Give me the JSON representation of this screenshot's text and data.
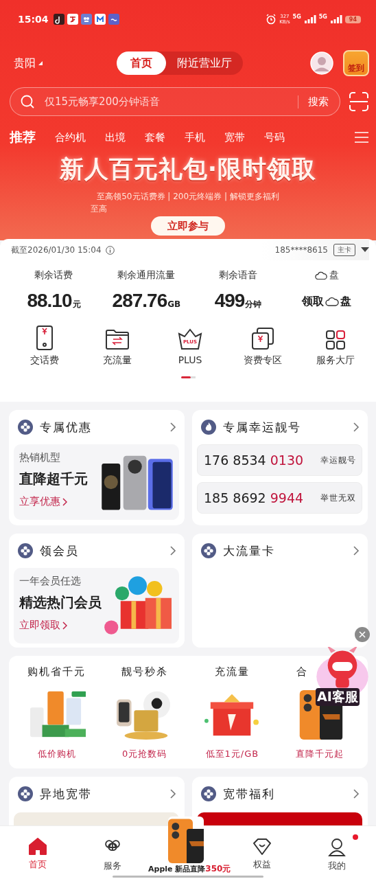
{
  "status_bar": {
    "time": "15:04",
    "speed": "327",
    "speed_unit": "KB/s",
    "network_1": "5G",
    "network_2": "5G",
    "battery": "94"
  },
  "header": {
    "city": "贵阳",
    "tabs": [
      {
        "label": "首页",
        "selected": true
      },
      {
        "label": "附近营业厅",
        "selected": false
      }
    ],
    "checkin": "签到"
  },
  "search": {
    "placeholder": "仅15元畅享200分钟语音",
    "button": "搜索"
  },
  "categories": [
    {
      "label": "推荐",
      "selected": true
    },
    {
      "label": "合约机",
      "selected": false
    },
    {
      "label": "出境",
      "selected": false
    },
    {
      "label": "套餐",
      "selected": false
    },
    {
      "label": "手机",
      "selected": false
    },
    {
      "label": "宽带",
      "selected": false
    },
    {
      "label": "号码",
      "selected": false
    }
  ],
  "banner": {
    "title": "新人百元礼包·限时领取",
    "subtitle": "至高领50元话费券 | 200元终端券 | 解锁更多福利",
    "subtitle_2": "至高",
    "button": "立即参与"
  },
  "account": {
    "timestamp": "截至2026/01/30 15:04",
    "phone": "185****8615",
    "card_tag": "主卡"
  },
  "balances": [
    {
      "kind": "amount",
      "label": "剩余话费",
      "value": "88.10",
      "unit": "元"
    },
    {
      "kind": "amount",
      "label": "剩余通用流量",
      "value": "287.76",
      "unit": "GB"
    },
    {
      "kind": "amount",
      "label": "剩余语音",
      "value": "499",
      "unit": "分钟"
    },
    {
      "kind": "cloud",
      "label": "盘",
      "value": "领取",
      "unit": "盘"
    }
  ],
  "shortcuts": [
    {
      "label": "交话费"
    },
    {
      "label": "充流量"
    },
    {
      "label": "PLUS",
      "icon_text": "PLUS"
    },
    {
      "label": "资费专区"
    },
    {
      "label": "服务大厅"
    }
  ],
  "pager": [
    {
      "selected": true
    },
    {
      "selected": false
    }
  ],
  "cards": [
    {
      "kind": "promo",
      "title": "专属优惠",
      "tag": "热销机型",
      "headline": "直降超千元",
      "link": "立享优惠"
    },
    {
      "kind": "numbers",
      "title": "专属幸运靓号",
      "numbers": [
        {
          "prefix": "176 8534",
          "highlight": "0130",
          "note": "幸运靓号"
        },
        {
          "prefix": "185 8692",
          "highlight": "9944",
          "note": "举世无双"
        }
      ]
    },
    {
      "kind": "promo",
      "title": "领会员",
      "tag": "一年会员任选",
      "headline": "精选热门会员",
      "link": "立即领取"
    },
    {
      "kind": "empty",
      "title": "大流量卡"
    }
  ],
  "deals": [
    {
      "title": "购机省千元",
      "caption": "低价购机"
    },
    {
      "title": "靓号秒杀",
      "caption": "0元抢数码"
    },
    {
      "title": "充流量",
      "caption": "低至1元/GB"
    },
    {
      "title": "合",
      "caption": "直降千元起"
    }
  ],
  "bottom_cards": [
    {
      "kind": "banner",
      "title": "异地宽带"
    },
    {
      "kind": "banner",
      "title": "宽带福利"
    }
  ],
  "ai_button": {
    "label": "AI客服"
  },
  "nav": {
    "items": [
      {
        "label": "首页",
        "selected": true
      },
      {
        "label": "服务",
        "selected": false
      },
      {
        "label": "权益",
        "selected": false
      },
      {
        "label": "我的",
        "selected": false,
        "badge": true
      }
    ],
    "promo_text": "Apple 新品直降",
    "promo_highlight": "350元"
  }
}
